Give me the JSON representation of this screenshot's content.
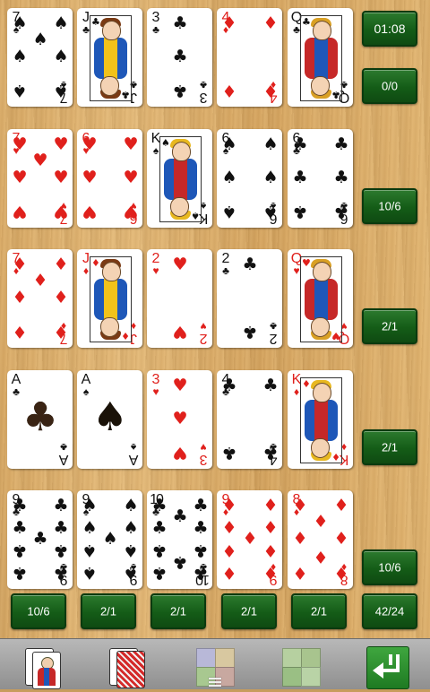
{
  "colors": {
    "red": "#e0201c",
    "black": "#111111",
    "button_green": "#145c17",
    "felt_wood": "#dcae6b"
  },
  "timer": "01:08",
  "score": "0/0",
  "row_counts": [
    "10/6",
    "2/1",
    "2/1",
    "10/6"
  ],
  "column_counts": [
    "10/6",
    "2/1",
    "2/1",
    "2/1",
    "2/1",
    "42/24"
  ],
  "rows": [
    [
      {
        "rank": "7",
        "suit": "♠",
        "color": "black"
      },
      {
        "rank": "J",
        "suit": "♣",
        "color": "black",
        "face": true
      },
      {
        "rank": "3",
        "suit": "♣",
        "color": "black"
      },
      {
        "rank": "4",
        "suit": "♦",
        "color": "red"
      },
      {
        "rank": "Q",
        "suit": "♣",
        "color": "black",
        "face": true
      }
    ],
    [
      {
        "rank": "7",
        "suit": "♥",
        "color": "red"
      },
      {
        "rank": "6",
        "suit": "♥",
        "color": "red"
      },
      {
        "rank": "K",
        "suit": "♠",
        "color": "black",
        "face": true
      },
      {
        "rank": "6",
        "suit": "♠",
        "color": "black"
      },
      {
        "rank": "6",
        "suit": "♣",
        "color": "black"
      }
    ],
    [
      {
        "rank": "7",
        "suit": "♦",
        "color": "red"
      },
      {
        "rank": "J",
        "suit": "♦",
        "color": "red",
        "face": true
      },
      {
        "rank": "2",
        "suit": "♥",
        "color": "red"
      },
      {
        "rank": "2",
        "suit": "♣",
        "color": "black"
      },
      {
        "rank": "Q",
        "suit": "♥",
        "color": "red",
        "face": true
      }
    ],
    [
      {
        "rank": "A",
        "suit": "♣",
        "color": "black"
      },
      {
        "rank": "A",
        "suit": "♠",
        "color": "black"
      },
      {
        "rank": "3",
        "suit": "♥",
        "color": "red"
      },
      {
        "rank": "4",
        "suit": "♣",
        "color": "black"
      },
      {
        "rank": "K",
        "suit": "♦",
        "color": "red",
        "face": true
      }
    ],
    [
      {
        "rank": "9",
        "suit": "♣",
        "color": "black"
      },
      {
        "rank": "9",
        "suit": "♠",
        "color": "black"
      },
      {
        "rank": "10",
        "suit": "♣",
        "color": "black"
      },
      {
        "rank": "9",
        "suit": "♦",
        "color": "red"
      },
      {
        "rank": "8",
        "suit": "♦",
        "color": "red"
      }
    ]
  ],
  "toolbar": {
    "items": [
      "face-cards-icon",
      "card-back-icon",
      "background-tiles-icon",
      "felt-tiles-icon",
      "undo-arrow-icon"
    ]
  }
}
